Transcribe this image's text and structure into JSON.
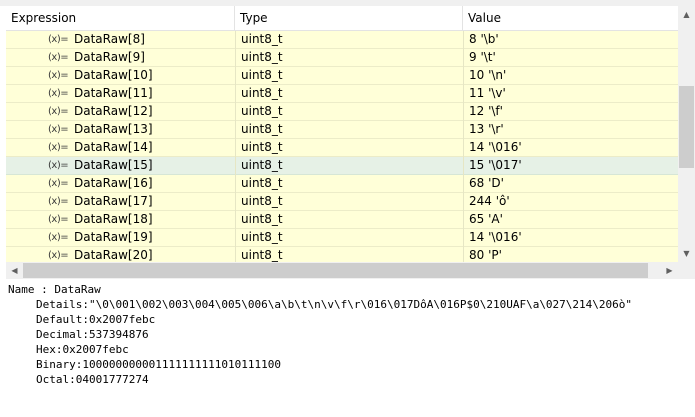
{
  "columns": {
    "expression": "Expression",
    "type": "Type",
    "value": "Value"
  },
  "variable_icon": "variable-icon",
  "rows": [
    {
      "name": "DataRaw[8]",
      "type": "uint8_t",
      "value": "8 '\\b'"
    },
    {
      "name": "DataRaw[9]",
      "type": "uint8_t",
      "value": "9 '\\t'"
    },
    {
      "name": "DataRaw[10]",
      "type": "uint8_t",
      "value": "10 '\\n'"
    },
    {
      "name": "DataRaw[11]",
      "type": "uint8_t",
      "value": "11 '\\v'"
    },
    {
      "name": "DataRaw[12]",
      "type": "uint8_t",
      "value": "12 '\\f'"
    },
    {
      "name": "DataRaw[13]",
      "type": "uint8_t",
      "value": "13 '\\r'"
    },
    {
      "name": "DataRaw[14]",
      "type": "uint8_t",
      "value": "14 '\\016'"
    },
    {
      "name": "DataRaw[15]",
      "type": "uint8_t",
      "value": "15 '\\017'",
      "selected": true
    },
    {
      "name": "DataRaw[16]",
      "type": "uint8_t",
      "value": "68 'D'"
    },
    {
      "name": "DataRaw[17]",
      "type": "uint8_t",
      "value": "244 'ô'"
    },
    {
      "name": "DataRaw[18]",
      "type": "uint8_t",
      "value": "65 'A'"
    },
    {
      "name": "DataRaw[19]",
      "type": "uint8_t",
      "value": "14 '\\016'"
    },
    {
      "name": "DataRaw[20]",
      "type": "uint8_t",
      "value": "80 'P'"
    }
  ],
  "details": {
    "name": "Name : DataRaw",
    "details": "Details:\"\\0\\001\\002\\003\\004\\005\\006\\a\\b\\t\\n\\v\\f\\r\\016\\017DôA\\016P$0\\210UAF\\a\\027\\214\\206ò\"",
    "default": "Default:0x2007febc",
    "decimal": "Decimal:537394876",
    "hex": "Hex:0x2007febc",
    "binary": "Binary:100000000001111111111010111100",
    "octal": "Octal:04001777274"
  }
}
